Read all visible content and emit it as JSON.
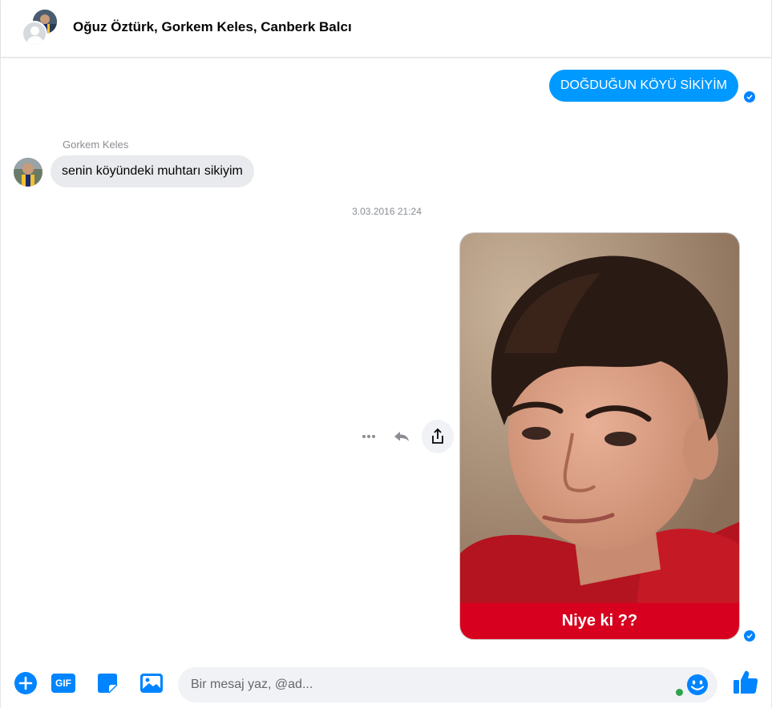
{
  "header": {
    "title": "Oğuz Öztürk, Gorkem Keles, Canberk Balcı"
  },
  "messages": {
    "outgoing_1": {
      "text": "DOĞDUĞUN KÖYÜ SİKİYİM"
    },
    "incoming_1": {
      "sender": "Gorkem Keles",
      "text": "senin köyündeki muhtarı sikiyim"
    },
    "timestamp": "3.03.2016 21:24",
    "outgoing_image": {
      "caption": "Niye ki ??"
    }
  },
  "composer": {
    "placeholder": "Bir mesaj yaz, @ad...",
    "gif_label": "GIF"
  },
  "colors": {
    "accent": "#0099ff",
    "seen_blue": "#0084ff",
    "caption_red": "#d7001e",
    "incoming_bubble": "#e9eaed",
    "online_green": "#31a24c"
  },
  "icons": [
    "add-icon",
    "gif-icon",
    "sticker-icon",
    "photo-icon",
    "emoji-icon",
    "like-icon",
    "more-icon",
    "reply-icon",
    "share-icon",
    "seen-check-icon"
  ]
}
